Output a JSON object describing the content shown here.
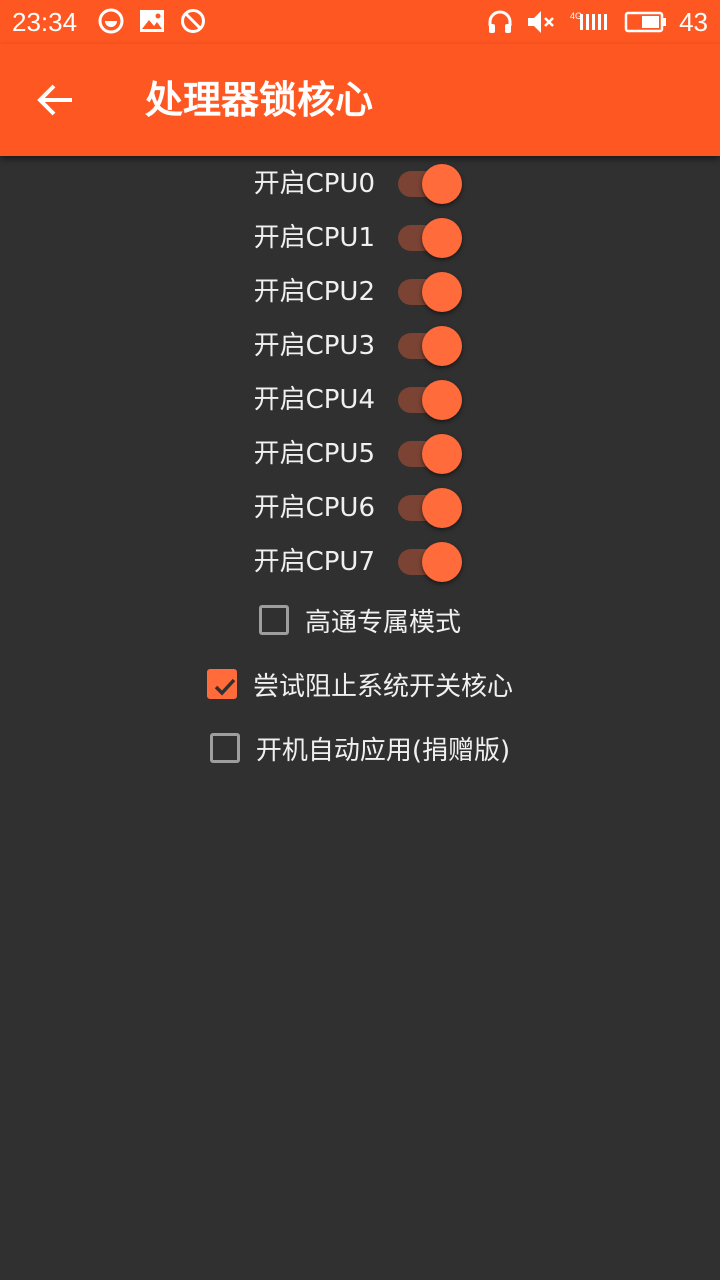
{
  "status_bar": {
    "time": "23:34",
    "battery_percent": "43",
    "left_icons": [
      "circle-badge-icon",
      "image-icon",
      "no-sign-icon"
    ],
    "right_icons": [
      "headset-icon",
      "volume-muted-icon",
      "signal-icon",
      "battery-icon"
    ]
  },
  "app_bar": {
    "title": "处理器锁核心",
    "back_icon": "arrow-left-icon"
  },
  "colors": {
    "accent": "#ff5722",
    "switch_thumb": "#ff6b3a",
    "switch_track": "#7a4333",
    "background": "#303030"
  },
  "cpu_switches": [
    {
      "label": "开启CPU0",
      "on": true
    },
    {
      "label": "开启CPU1",
      "on": true
    },
    {
      "label": "开启CPU2",
      "on": true
    },
    {
      "label": "开启CPU3",
      "on": true
    },
    {
      "label": "开启CPU4",
      "on": true
    },
    {
      "label": "开启CPU5",
      "on": true
    },
    {
      "label": "开启CPU6",
      "on": true
    },
    {
      "label": "开启CPU7",
      "on": true
    }
  ],
  "options": [
    {
      "label": "高通专属模式",
      "checked": false
    },
    {
      "label": "尝试阻止系统开关核心",
      "checked": true
    },
    {
      "label": "开机自动应用(捐赠版)",
      "checked": false
    }
  ]
}
